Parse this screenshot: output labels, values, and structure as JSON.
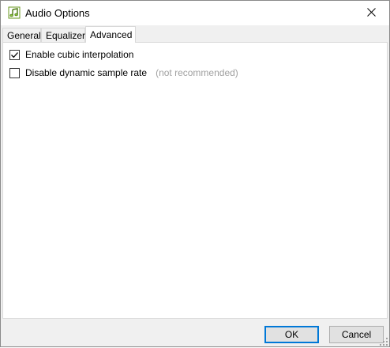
{
  "window": {
    "title": "Audio Options",
    "app_icon": "music-note-icon",
    "close_icon": "close-icon"
  },
  "tabs": [
    {
      "label": "General",
      "active": false
    },
    {
      "label": "Equalizer",
      "active": false
    },
    {
      "label": "Advanced",
      "active": true
    }
  ],
  "advanced": {
    "options": [
      {
        "label": "Enable cubic interpolation",
        "checked": true,
        "hint": ""
      },
      {
        "label": "Disable dynamic sample rate",
        "checked": false,
        "hint": "(not recommended)"
      }
    ]
  },
  "footer": {
    "ok_label": "OK",
    "cancel_label": "Cancel"
  },
  "colors": {
    "accent": "#0078d7",
    "icon_green": "#6a9a1f",
    "hint": "#a0a0a0"
  }
}
